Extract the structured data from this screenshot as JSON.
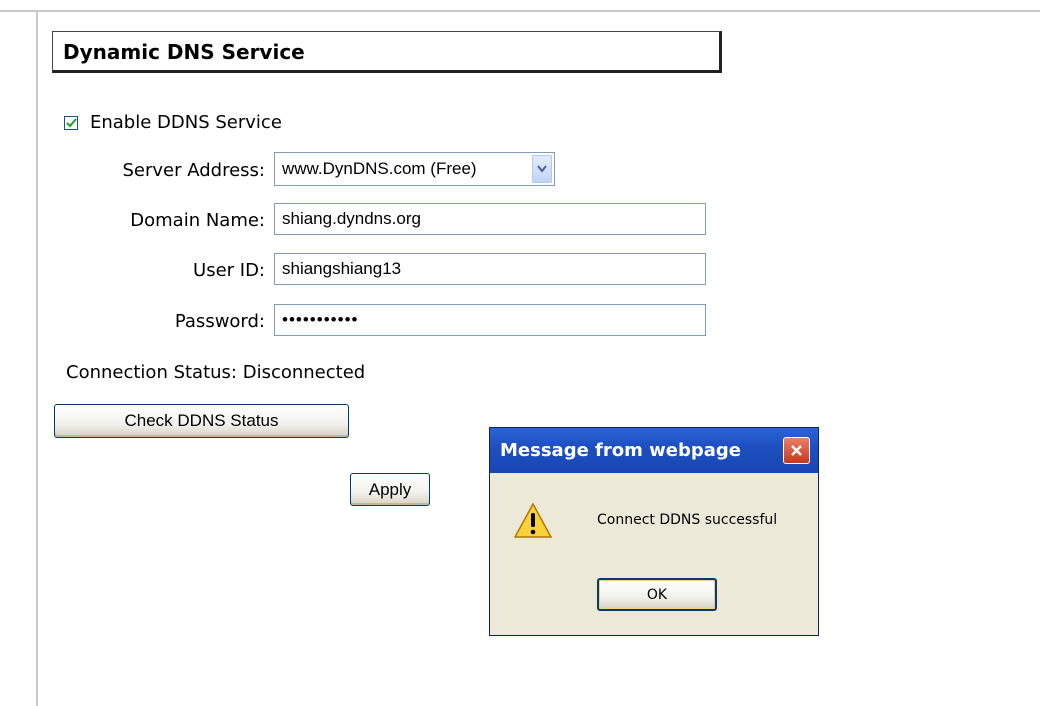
{
  "section": {
    "title": "Dynamic DNS Service"
  },
  "enable": {
    "label": "Enable DDNS Service",
    "checked": true
  },
  "form": {
    "server_address": {
      "label": "Server Address:",
      "value": "www.DynDNS.com (Free)"
    },
    "domain_name": {
      "label": "Domain Name:",
      "value": "shiang.dyndns.org"
    },
    "user_id": {
      "label": "User ID:",
      "value": "shiangshiang13"
    },
    "password": {
      "label": "Password:",
      "value": "•••••••••••"
    }
  },
  "status": {
    "text": "Connection Status: Disconnected"
  },
  "buttons": {
    "check": "Check DDNS Status",
    "apply": "Apply"
  },
  "dialog": {
    "title": "Message from webpage",
    "message": "Connect DDNS successful",
    "ok": "OK",
    "icon": "warning-icon"
  },
  "colors": {
    "titlebar": "#1f4fc0",
    "dialog_bg": "#ece9d8",
    "field_border": "#7f9db9",
    "close_button": "#c8381c"
  }
}
